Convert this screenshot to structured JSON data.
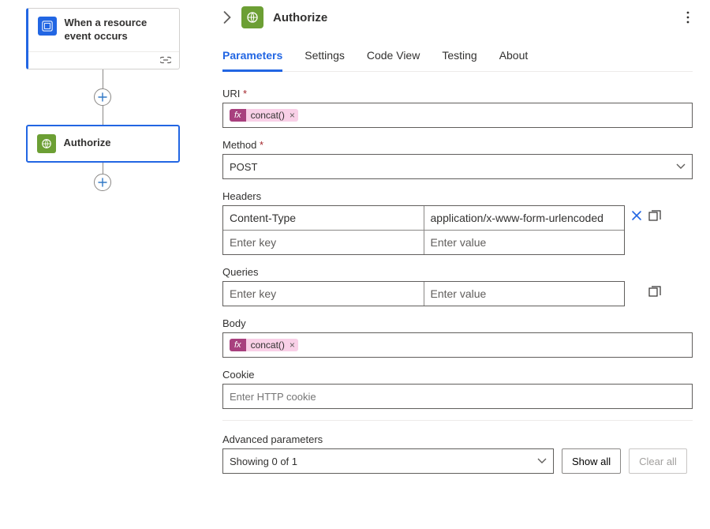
{
  "canvas": {
    "trigger": {
      "title": "When a resource event occurs"
    },
    "action": {
      "title": "Authorize"
    }
  },
  "panel": {
    "title": "Authorize",
    "tabs": [
      {
        "label": "Parameters",
        "active": true
      },
      {
        "label": "Settings",
        "active": false
      },
      {
        "label": "Code View",
        "active": false
      },
      {
        "label": "Testing",
        "active": false
      },
      {
        "label": "About",
        "active": false
      }
    ],
    "fields": {
      "uri": {
        "label": "URI",
        "token": "concat()"
      },
      "method": {
        "label": "Method",
        "value": "POST"
      },
      "headers": {
        "label": "Headers",
        "rows": [
          {
            "key": "Content-Type",
            "value": "application/x-www-form-urlencoded"
          }
        ],
        "keyPlaceholder": "Enter key",
        "valuePlaceholder": "Enter value"
      },
      "queries": {
        "label": "Queries",
        "keyPlaceholder": "Enter key",
        "valuePlaceholder": "Enter value"
      },
      "body": {
        "label": "Body",
        "token": "concat()"
      },
      "cookie": {
        "label": "Cookie",
        "placeholder": "Enter HTTP cookie"
      }
    },
    "advanced": {
      "label": "Advanced parameters",
      "selectText": "Showing 0 of 1",
      "showAll": "Show all",
      "clearAll": "Clear all"
    }
  }
}
